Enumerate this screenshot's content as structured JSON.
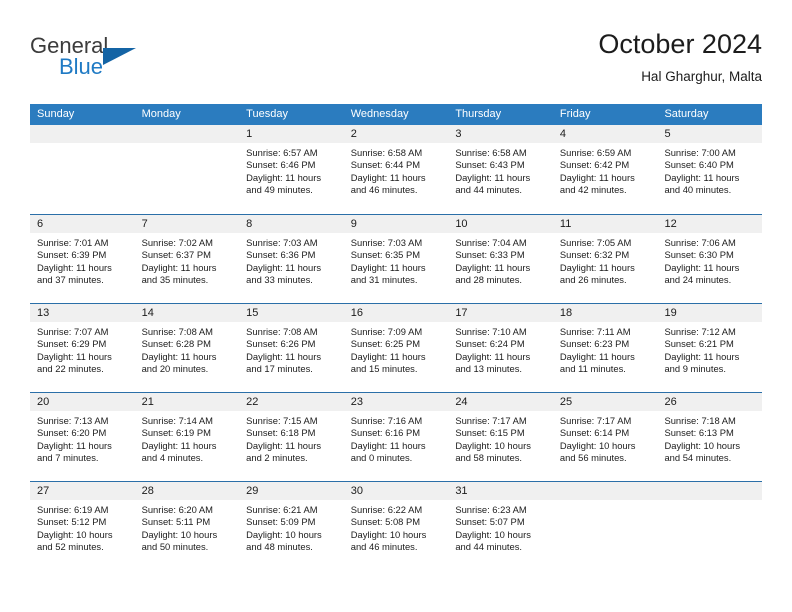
{
  "brand": {
    "word1": "General",
    "word2": "Blue",
    "flag_color": "#1464a5",
    "blue_color": "#1f7ac4"
  },
  "header": {
    "title": "October 2024",
    "location": "Hal Gharghur, Malta"
  },
  "calendar": {
    "accent_color": "#2b7cbf",
    "weekdays": [
      "Sunday",
      "Monday",
      "Tuesday",
      "Wednesday",
      "Thursday",
      "Friday",
      "Saturday"
    ],
    "weeks": [
      [
        {
          "day": "",
          "sunrise": "",
          "sunset": "",
          "daylight1": "",
          "daylight2": ""
        },
        {
          "day": "",
          "sunrise": "",
          "sunset": "",
          "daylight1": "",
          "daylight2": ""
        },
        {
          "day": "1",
          "sunrise": "Sunrise: 6:57 AM",
          "sunset": "Sunset: 6:46 PM",
          "daylight1": "Daylight: 11 hours",
          "daylight2": "and 49 minutes."
        },
        {
          "day": "2",
          "sunrise": "Sunrise: 6:58 AM",
          "sunset": "Sunset: 6:44 PM",
          "daylight1": "Daylight: 11 hours",
          "daylight2": "and 46 minutes."
        },
        {
          "day": "3",
          "sunrise": "Sunrise: 6:58 AM",
          "sunset": "Sunset: 6:43 PM",
          "daylight1": "Daylight: 11 hours",
          "daylight2": "and 44 minutes."
        },
        {
          "day": "4",
          "sunrise": "Sunrise: 6:59 AM",
          "sunset": "Sunset: 6:42 PM",
          "daylight1": "Daylight: 11 hours",
          "daylight2": "and 42 minutes."
        },
        {
          "day": "5",
          "sunrise": "Sunrise: 7:00 AM",
          "sunset": "Sunset: 6:40 PM",
          "daylight1": "Daylight: 11 hours",
          "daylight2": "and 40 minutes."
        }
      ],
      [
        {
          "day": "6",
          "sunrise": "Sunrise: 7:01 AM",
          "sunset": "Sunset: 6:39 PM",
          "daylight1": "Daylight: 11 hours",
          "daylight2": "and 37 minutes."
        },
        {
          "day": "7",
          "sunrise": "Sunrise: 7:02 AM",
          "sunset": "Sunset: 6:37 PM",
          "daylight1": "Daylight: 11 hours",
          "daylight2": "and 35 minutes."
        },
        {
          "day": "8",
          "sunrise": "Sunrise: 7:03 AM",
          "sunset": "Sunset: 6:36 PM",
          "daylight1": "Daylight: 11 hours",
          "daylight2": "and 33 minutes."
        },
        {
          "day": "9",
          "sunrise": "Sunrise: 7:03 AM",
          "sunset": "Sunset: 6:35 PM",
          "daylight1": "Daylight: 11 hours",
          "daylight2": "and 31 minutes."
        },
        {
          "day": "10",
          "sunrise": "Sunrise: 7:04 AM",
          "sunset": "Sunset: 6:33 PM",
          "daylight1": "Daylight: 11 hours",
          "daylight2": "and 28 minutes."
        },
        {
          "day": "11",
          "sunrise": "Sunrise: 7:05 AM",
          "sunset": "Sunset: 6:32 PM",
          "daylight1": "Daylight: 11 hours",
          "daylight2": "and 26 minutes."
        },
        {
          "day": "12",
          "sunrise": "Sunrise: 7:06 AM",
          "sunset": "Sunset: 6:30 PM",
          "daylight1": "Daylight: 11 hours",
          "daylight2": "and 24 minutes."
        }
      ],
      [
        {
          "day": "13",
          "sunrise": "Sunrise: 7:07 AM",
          "sunset": "Sunset: 6:29 PM",
          "daylight1": "Daylight: 11 hours",
          "daylight2": "and 22 minutes."
        },
        {
          "day": "14",
          "sunrise": "Sunrise: 7:08 AM",
          "sunset": "Sunset: 6:28 PM",
          "daylight1": "Daylight: 11 hours",
          "daylight2": "and 20 minutes."
        },
        {
          "day": "15",
          "sunrise": "Sunrise: 7:08 AM",
          "sunset": "Sunset: 6:26 PM",
          "daylight1": "Daylight: 11 hours",
          "daylight2": "and 17 minutes."
        },
        {
          "day": "16",
          "sunrise": "Sunrise: 7:09 AM",
          "sunset": "Sunset: 6:25 PM",
          "daylight1": "Daylight: 11 hours",
          "daylight2": "and 15 minutes."
        },
        {
          "day": "17",
          "sunrise": "Sunrise: 7:10 AM",
          "sunset": "Sunset: 6:24 PM",
          "daylight1": "Daylight: 11 hours",
          "daylight2": "and 13 minutes."
        },
        {
          "day": "18",
          "sunrise": "Sunrise: 7:11 AM",
          "sunset": "Sunset: 6:23 PM",
          "daylight1": "Daylight: 11 hours",
          "daylight2": "and 11 minutes."
        },
        {
          "day": "19",
          "sunrise": "Sunrise: 7:12 AM",
          "sunset": "Sunset: 6:21 PM",
          "daylight1": "Daylight: 11 hours",
          "daylight2": "and 9 minutes."
        }
      ],
      [
        {
          "day": "20",
          "sunrise": "Sunrise: 7:13 AM",
          "sunset": "Sunset: 6:20 PM",
          "daylight1": "Daylight: 11 hours",
          "daylight2": "and 7 minutes."
        },
        {
          "day": "21",
          "sunrise": "Sunrise: 7:14 AM",
          "sunset": "Sunset: 6:19 PM",
          "daylight1": "Daylight: 11 hours",
          "daylight2": "and 4 minutes."
        },
        {
          "day": "22",
          "sunrise": "Sunrise: 7:15 AM",
          "sunset": "Sunset: 6:18 PM",
          "daylight1": "Daylight: 11 hours",
          "daylight2": "and 2 minutes."
        },
        {
          "day": "23",
          "sunrise": "Sunrise: 7:16 AM",
          "sunset": "Sunset: 6:16 PM",
          "daylight1": "Daylight: 11 hours",
          "daylight2": "and 0 minutes."
        },
        {
          "day": "24",
          "sunrise": "Sunrise: 7:17 AM",
          "sunset": "Sunset: 6:15 PM",
          "daylight1": "Daylight: 10 hours",
          "daylight2": "and 58 minutes."
        },
        {
          "day": "25",
          "sunrise": "Sunrise: 7:17 AM",
          "sunset": "Sunset: 6:14 PM",
          "daylight1": "Daylight: 10 hours",
          "daylight2": "and 56 minutes."
        },
        {
          "day": "26",
          "sunrise": "Sunrise: 7:18 AM",
          "sunset": "Sunset: 6:13 PM",
          "daylight1": "Daylight: 10 hours",
          "daylight2": "and 54 minutes."
        }
      ],
      [
        {
          "day": "27",
          "sunrise": "Sunrise: 6:19 AM",
          "sunset": "Sunset: 5:12 PM",
          "daylight1": "Daylight: 10 hours",
          "daylight2": "and 52 minutes."
        },
        {
          "day": "28",
          "sunrise": "Sunrise: 6:20 AM",
          "sunset": "Sunset: 5:11 PM",
          "daylight1": "Daylight: 10 hours",
          "daylight2": "and 50 minutes."
        },
        {
          "day": "29",
          "sunrise": "Sunrise: 6:21 AM",
          "sunset": "Sunset: 5:09 PM",
          "daylight1": "Daylight: 10 hours",
          "daylight2": "and 48 minutes."
        },
        {
          "day": "30",
          "sunrise": "Sunrise: 6:22 AM",
          "sunset": "Sunset: 5:08 PM",
          "daylight1": "Daylight: 10 hours",
          "daylight2": "and 46 minutes."
        },
        {
          "day": "31",
          "sunrise": "Sunrise: 6:23 AM",
          "sunset": "Sunset: 5:07 PM",
          "daylight1": "Daylight: 10 hours",
          "daylight2": "and 44 minutes."
        },
        {
          "day": "",
          "sunrise": "",
          "sunset": "",
          "daylight1": "",
          "daylight2": ""
        },
        {
          "day": "",
          "sunrise": "",
          "sunset": "",
          "daylight1": "",
          "daylight2": ""
        }
      ]
    ]
  }
}
